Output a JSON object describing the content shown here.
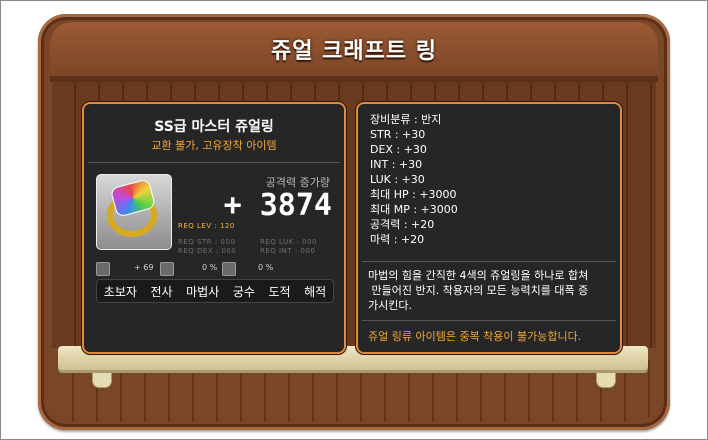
{
  "title": "쥬얼 크래프트 링",
  "item": {
    "name": "SS급 마스터 쥬얼링",
    "subtitle": "교환 불가, 고유장착 아이템",
    "increase_label": "공격력 증가량",
    "increase_value": "+ 3874",
    "req_lev": "REQ LEV : 120",
    "req_str": "REQ STR : 000",
    "req_luk": "REQ LUK : 000",
    "req_dex": "REQ DEX : 000",
    "req_int": "REQ INT : 000",
    "upgrade": "+ 69",
    "pct1": "0 %",
    "pct2": "0 %",
    "jobs": [
      "초보자",
      "전사",
      "마법사",
      "궁수",
      "도적",
      "해적"
    ]
  },
  "stats": [
    "장비분류 : 반지",
    "STR : +30",
    "DEX : +30",
    "INT : +30",
    "LUK : +30",
    "최대 HP : +3000",
    "최대 MP : +3000",
    "공격력 : +20",
    "마력 : +20"
  ],
  "description_lines": [
    "마법의 힘을 간직한 4색의 쥬얼링을 하나로 합쳐",
    " 만들어진 반지. 착용자의 모든 능력치를 대폭 증",
    "가시킨다."
  ],
  "warning": "쥬얼 링류 아이템은 중복 착용이 불가능합니다."
}
